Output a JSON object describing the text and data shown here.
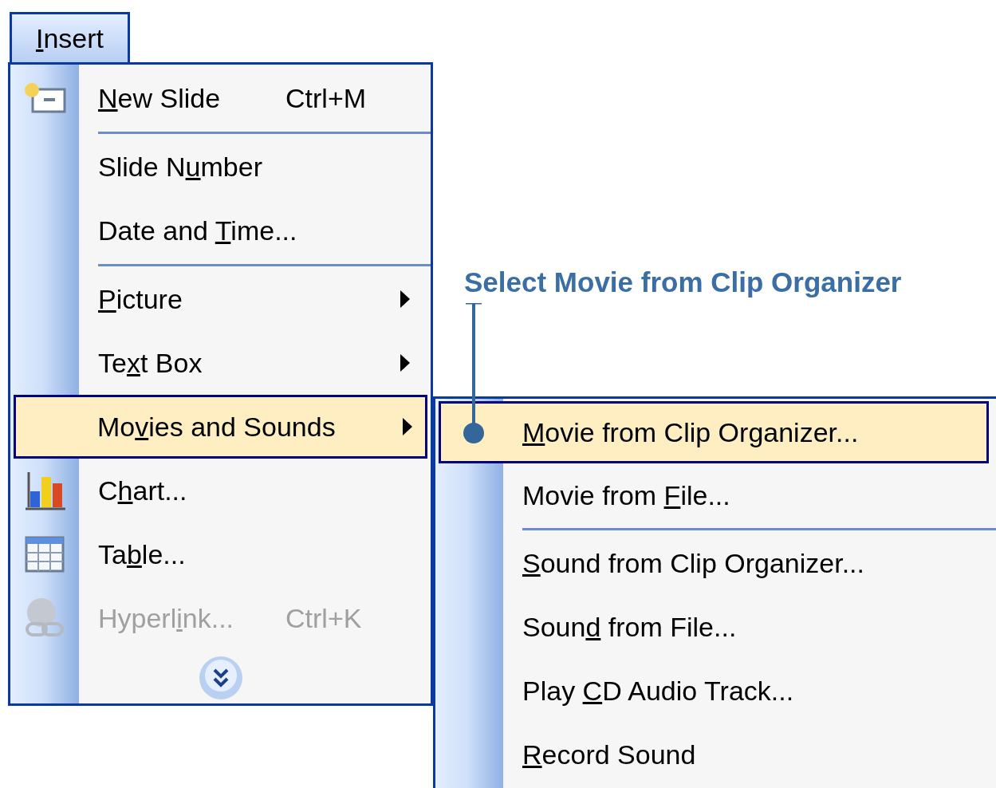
{
  "menu_bar": {
    "access_key": "I",
    "label_post": "nsert",
    "selected": true
  },
  "menu": {
    "items": [
      {
        "kind": "item",
        "access_key": "N",
        "label_post": "ew Slide",
        "shortcut": "Ctrl+M",
        "submenu": false,
        "selected": false,
        "disabled": false
      },
      {
        "kind": "separator"
      },
      {
        "kind": "item",
        "label_pre": "Slide N",
        "access_key": "u",
        "label_post": "mber",
        "submenu": false,
        "selected": false,
        "disabled": false
      },
      {
        "kind": "item",
        "label_pre": "Date and ",
        "access_key": "T",
        "label_post": "ime...",
        "submenu": false,
        "selected": false,
        "disabled": false
      },
      {
        "kind": "separator"
      },
      {
        "kind": "item",
        "access_key": "P",
        "label_post": "icture",
        "submenu": true,
        "selected": false,
        "disabled": false
      },
      {
        "kind": "item",
        "label_pre": "Te",
        "access_key": "x",
        "label_post": "t Box",
        "submenu": true,
        "selected": false,
        "disabled": false
      },
      {
        "kind": "item",
        "label_pre": "Mo",
        "access_key": "v",
        "label_post": "ies and Sounds",
        "submenu": true,
        "selected": true,
        "disabled": false
      },
      {
        "kind": "item",
        "label_pre": "C",
        "access_key": "h",
        "label_post": "art...",
        "submenu": false,
        "selected": false,
        "disabled": false
      },
      {
        "kind": "item",
        "label_pre": "Ta",
        "access_key": "b",
        "label_post": "le...",
        "submenu": false,
        "selected": false,
        "disabled": false
      },
      {
        "kind": "item",
        "label_pre": "Hyperl",
        "access_key": "i",
        "label_post": "nk...",
        "shortcut": "Ctrl+K",
        "submenu": false,
        "selected": false,
        "disabled": true
      },
      {
        "kind": "more"
      }
    ]
  },
  "submenu": {
    "items": [
      {
        "kind": "item",
        "access_key": "M",
        "label_post": "ovie from Clip Organizer...",
        "selected": true
      },
      {
        "kind": "item",
        "label_pre": "Movie from ",
        "access_key": "F",
        "label_post": "ile...",
        "selected": false
      },
      {
        "kind": "separator"
      },
      {
        "kind": "item",
        "access_key": "S",
        "label_post": "ound from Clip Organizer...",
        "selected": false
      },
      {
        "kind": "item",
        "label_pre": "Soun",
        "access_key": "d",
        "label_post": " from File...",
        "selected": false
      },
      {
        "kind": "item",
        "label_pre": "Play ",
        "access_key": "C",
        "label_post": "D Audio Track...",
        "selected": false
      },
      {
        "kind": "item",
        "access_key": "R",
        "label_post": "ecord Sound",
        "selected": false
      }
    ]
  },
  "callout": {
    "text": "Select Movie from Clip Organizer"
  }
}
